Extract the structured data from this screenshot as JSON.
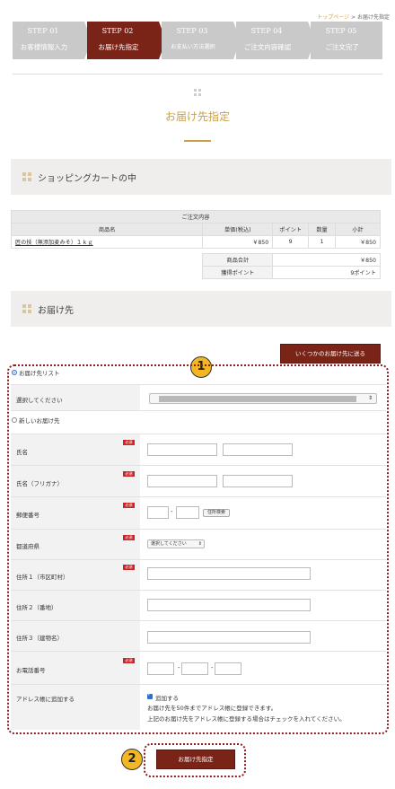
{
  "breadcrumb": {
    "home": "トップページ",
    "separator": " > ",
    "current": "お届け先指定"
  },
  "steps": [
    {
      "num": "STEP 01",
      "name": "お客様情報入力"
    },
    {
      "num": "STEP 02",
      "name": "お届け先指定"
    },
    {
      "num": "STEP 03",
      "name": "お支払い方法選択"
    },
    {
      "num": "STEP 04",
      "name": "ご注文内容確認"
    },
    {
      "num": "STEP 05",
      "name": "ご注文完了"
    }
  ],
  "page_title": "お届け先指定",
  "cart_section": {
    "title": "ショッピングカートの中"
  },
  "order_table": {
    "caption": "ご注文内容",
    "headers": [
      "商品名",
      "単価(税込)",
      "ポイント",
      "数量",
      "小計"
    ],
    "rows": [
      {
        "name": "匠の技（無添加麦みそ）１ｋｇ",
        "price": "￥850",
        "points": "9",
        "qty": "1",
        "subtotal": "￥850"
      }
    ],
    "summary": [
      {
        "label": "商品合計",
        "value": "￥850"
      },
      {
        "label": "獲得ポイント",
        "value": "9ポイント"
      }
    ]
  },
  "delivery_section": {
    "title": "お届け先"
  },
  "multi_address_button": "いくつかのお届け先に送る",
  "address_list": {
    "radio_label": "お届け先リスト",
    "select_label": "選択してください"
  },
  "new_address": {
    "radio_label": "新しいお届け先",
    "required_tag": "必須",
    "fields": {
      "name": "氏名",
      "kana": "氏名（フリガナ）",
      "zip": "郵便番号",
      "zip_search": "住所検索",
      "prefecture": "都道府県",
      "prefecture_placeholder": "選択してください",
      "address1": "住所１（市区町村）",
      "address2": "住所２（番地）",
      "address3": "住所３（建物名）",
      "phone": "お電話番号",
      "addressbook": "アドレス帳に追加する",
      "addressbook_check": "追加する",
      "addressbook_note1": "お届け先を50件までアドレス帳に登録できます。",
      "addressbook_note2": "上記のお届け先をアドレス帳に登録する場合はチェックを入れてください。"
    }
  },
  "submit_button": "お届け先指定",
  "annotations": {
    "badge1": "1",
    "badge2": "2"
  },
  "colors": {
    "accent": "#7a2418",
    "gold": "#c8a04a",
    "badge": "#f3b723",
    "required": "#cc2222"
  }
}
